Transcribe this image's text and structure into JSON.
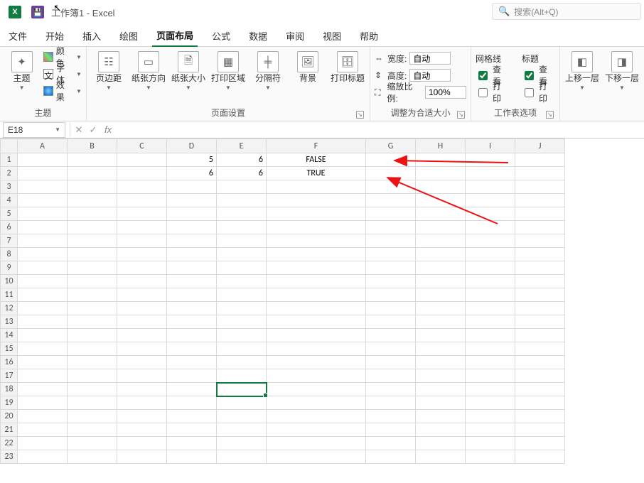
{
  "title": "工作簿1 - Excel",
  "search_placeholder": "搜索(Alt+Q)",
  "tabs": [
    "文件",
    "开始",
    "插入",
    "绘图",
    "页面布局",
    "公式",
    "数据",
    "审阅",
    "视图",
    "帮助"
  ],
  "active_tab": 4,
  "groups": {
    "theme": {
      "main": "主题",
      "colors": "颜色",
      "fonts": "字体",
      "effects": "效果",
      "label": "主题"
    },
    "page_setup": {
      "margins": "页边距",
      "orientation": "纸张方向",
      "size": "纸张大小",
      "print_area": "打印区域",
      "breaks": "分隔符",
      "background": "背景",
      "print_titles": "打印标题",
      "label": "页面设置"
    },
    "scale": {
      "width_lbl": "宽度:",
      "height_lbl": "高度:",
      "scale_lbl": "缩放比例:",
      "width_val": "自动",
      "height_val": "自动",
      "scale_val": "100%",
      "label": "调整为合适大小"
    },
    "sheet": {
      "gridlines": "网格线",
      "headings": "标题",
      "view": "查看",
      "print": "打印",
      "label": "工作表选项"
    },
    "arrange": {
      "bring_fwd": "上移一层",
      "send_back": "下移一层"
    }
  },
  "namebox": "E18",
  "columns": [
    "A",
    "B",
    "C",
    "D",
    "E",
    "F",
    "G",
    "H",
    "I",
    "J"
  ],
  "rows": 23,
  "cells": {
    "D1": "5",
    "E1": "6",
    "F1": "FALSE",
    "D2": "6",
    "E2": "6",
    "F2": "TRUE"
  },
  "selected": "E18"
}
